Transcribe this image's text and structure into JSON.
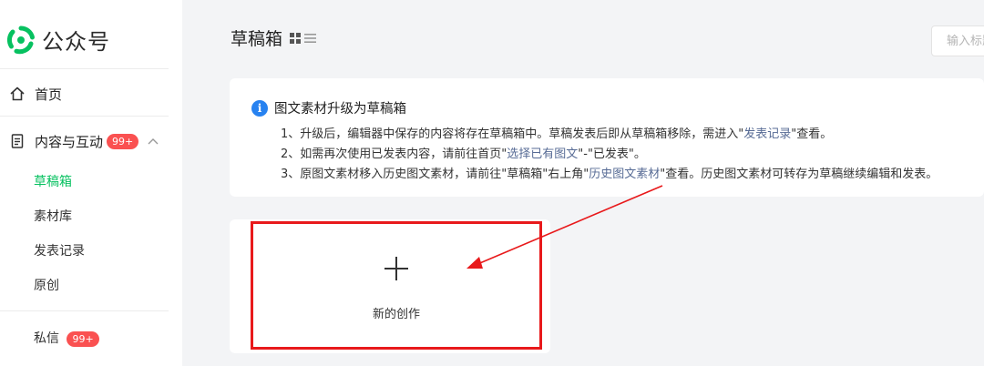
{
  "brand": {
    "name": "公众号",
    "icon": "wechat-official-logo-icon"
  },
  "sidebar": {
    "home": {
      "label": "首页",
      "icon": "home-icon"
    },
    "content": {
      "label": "内容与互动",
      "icon": "document-icon",
      "badge": "99+",
      "expanded": true
    },
    "sub_items": [
      {
        "label": "草稿箱",
        "active": true
      },
      {
        "label": "素材库"
      },
      {
        "label": "发表记录"
      },
      {
        "label": "原创"
      }
    ],
    "messages": {
      "label": "私信",
      "badge": "99+"
    }
  },
  "header": {
    "title": "草稿箱",
    "view_icons": [
      "grid-view-icon",
      "list-view-icon"
    ],
    "search_placeholder": "输入标题"
  },
  "notice": {
    "title": "图文素材升级为草稿箱",
    "line1": {
      "prefix": "1、升级后，编辑器中保存的内容将存在草稿箱中。草稿发表后即从草稿箱移除，需进入\"",
      "link": "发表记录",
      "suffix": "\"查看。"
    },
    "line2": {
      "prefix": "2、如需再次使用已发表内容，请前往首页\"",
      "link": "选择已有图文",
      "suffix": "\"-\"已发表\"。"
    },
    "line3": {
      "prefix": "3、原图文素材移入历史图文素材，请前往\"草稿箱\"右上角\"",
      "link": "历史图文素材",
      "suffix": "\"查看。历史图文素材可转存为草稿继续编辑和发表。"
    }
  },
  "new_creation": {
    "label": "新的创作",
    "icon": "plus-icon"
  },
  "colors": {
    "accent": "#07c160",
    "badge": "#fa5151",
    "link": "#576b95",
    "info": "#2782f0",
    "highlight": "#e8191b"
  }
}
